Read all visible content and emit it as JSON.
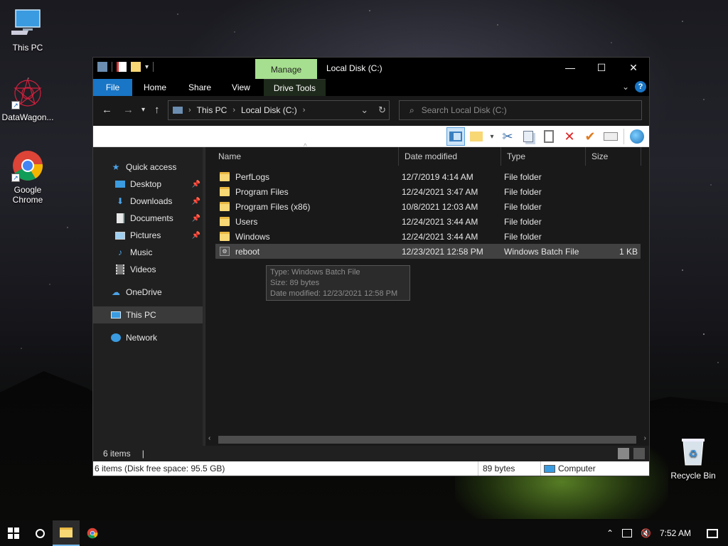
{
  "desktop": {
    "icons": [
      {
        "label": "This PC",
        "icon": "computer-icon"
      },
      {
        "label": "DataWagon...",
        "icon": "datawagon-icon"
      },
      {
        "label": "Google Chrome",
        "icon": "chrome-icon"
      },
      {
        "label": "Recycle Bin",
        "icon": "recycle-bin-icon"
      }
    ]
  },
  "window": {
    "title": "Local Disk (C:)",
    "manage_tab": "Manage",
    "ribbon_tabs": [
      "File",
      "Home",
      "Share",
      "View",
      "Drive Tools"
    ],
    "address": {
      "crumbs": [
        "This PC",
        "Local Disk (C:)"
      ]
    },
    "search_placeholder": "Search Local Disk (C:)",
    "columns": [
      "Name",
      "Date modified",
      "Type",
      "Size"
    ],
    "files": [
      {
        "name": "PerfLogs",
        "date": "12/7/2019 4:14 AM",
        "type": "File folder",
        "size": "",
        "kind": "folder"
      },
      {
        "name": "Program Files",
        "date": "12/24/2021 3:47 AM",
        "type": "File folder",
        "size": "",
        "kind": "folder"
      },
      {
        "name": "Program Files (x86)",
        "date": "10/8/2021 12:03 AM",
        "type": "File folder",
        "size": "",
        "kind": "folder"
      },
      {
        "name": "Users",
        "date": "12/24/2021 3:44 AM",
        "type": "File folder",
        "size": "",
        "kind": "folder"
      },
      {
        "name": "Windows",
        "date": "12/24/2021 3:44 AM",
        "type": "File folder",
        "size": "",
        "kind": "folder"
      },
      {
        "name": "reboot",
        "date": "12/23/2021 12:58 PM",
        "type": "Windows Batch File",
        "size": "1 KB",
        "kind": "batch"
      }
    ],
    "tooltip": {
      "type": "Type: Windows Batch File",
      "size": "Size: 89 bytes",
      "date": "Date modified: 12/23/2021 12:58 PM"
    },
    "nav": {
      "quick_access": "Quick access",
      "quick_items": [
        "Desktop",
        "Downloads",
        "Documents",
        "Pictures",
        "Music",
        "Videos"
      ],
      "onedrive": "OneDrive",
      "this_pc": "This PC",
      "network": "Network"
    },
    "status": {
      "count": "6 items",
      "cursor": "|"
    },
    "bottom": {
      "info": "6 items (Disk free space: 95.5 GB)",
      "bytes": "89 bytes",
      "computer": "Computer"
    }
  },
  "taskbar": {
    "time": "7:52 AM"
  },
  "colors": {
    "accent": "#1975c5",
    "manage_tab": "#a6df8f",
    "folder": "#f8d775"
  }
}
